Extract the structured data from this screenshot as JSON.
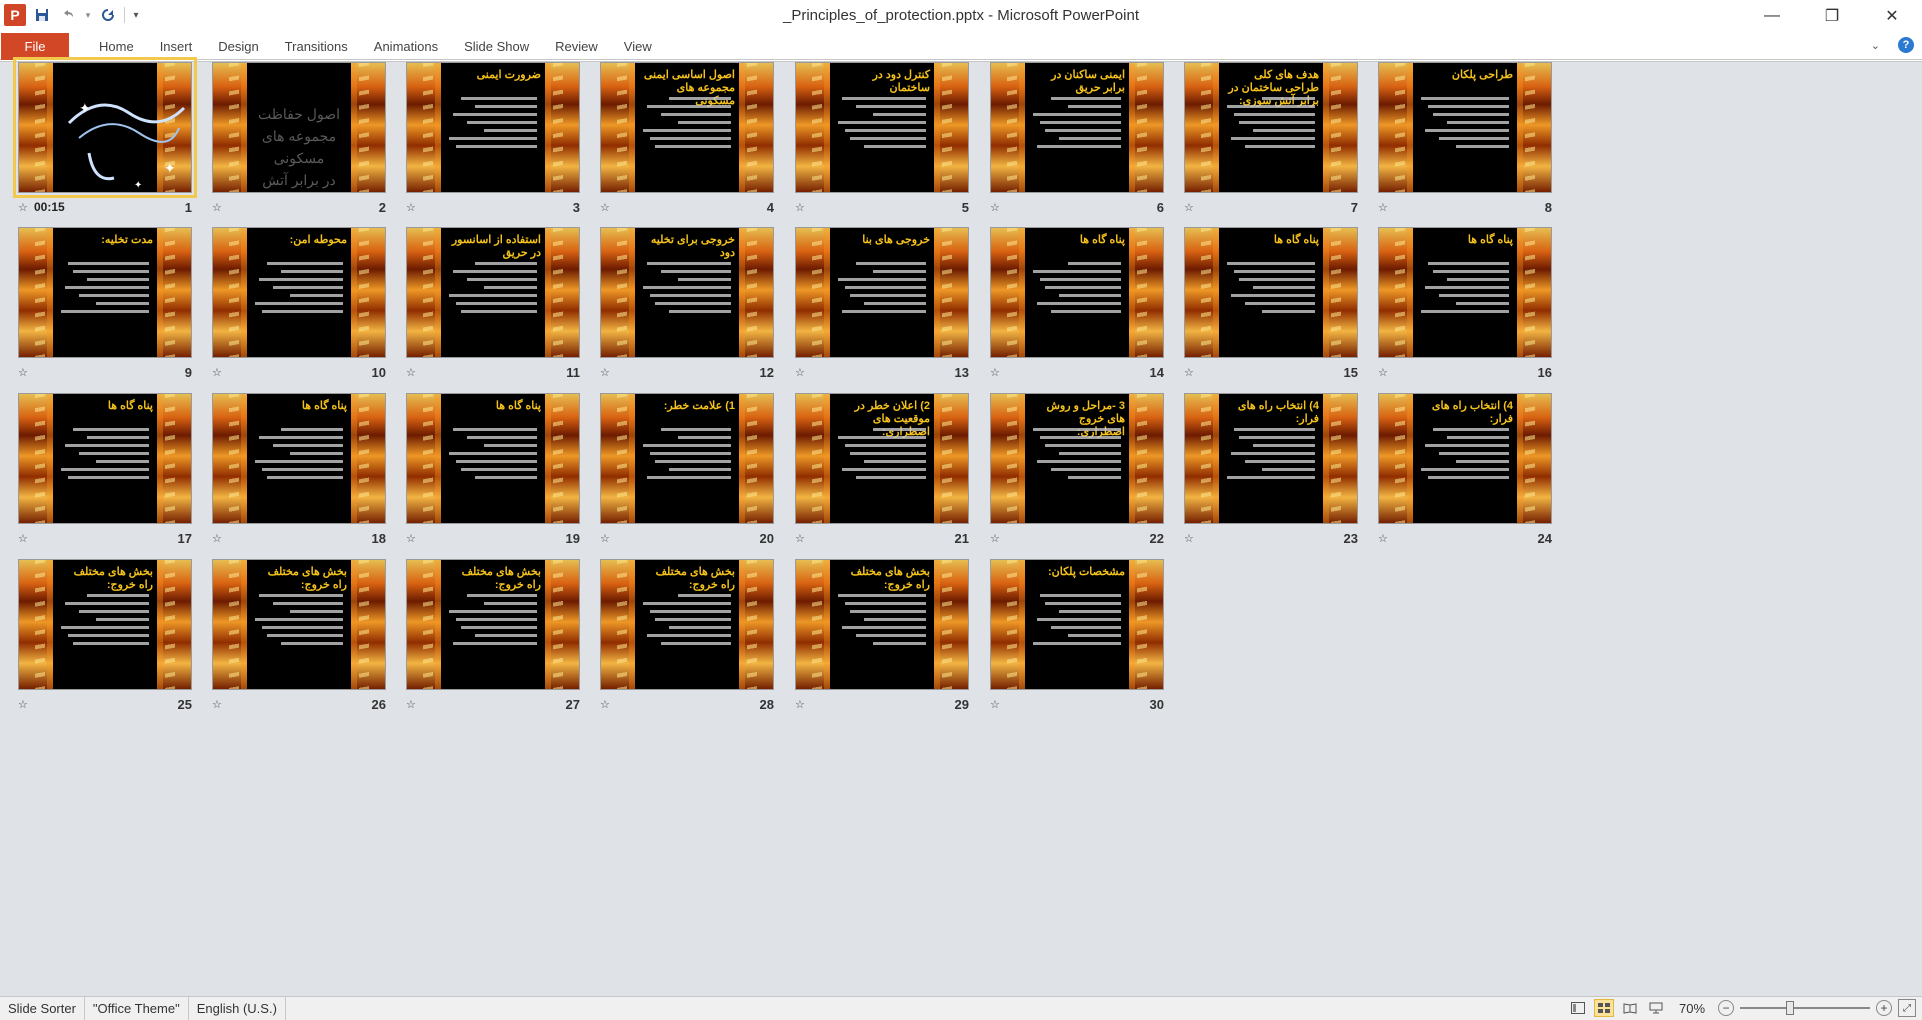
{
  "app": {
    "logo": "P",
    "window_title": "_Principles_of_protection.pptx - Microsoft PowerPoint"
  },
  "qat": {
    "save_icon": "save-icon",
    "undo_icon": "undo-icon",
    "redo_icon": "redo-icon",
    "customize_icon": "customize-icon"
  },
  "window_controls": {
    "minimize": "—",
    "restore": "❐",
    "close": "✕"
  },
  "ribbon": {
    "file_label": "File",
    "tabs": [
      "Home",
      "Insert",
      "Design",
      "Transitions",
      "Animations",
      "Slide Show",
      "Review",
      "View"
    ],
    "collapse_symbol": "⌄",
    "help_symbol": "?"
  },
  "slides": [
    {
      "number": "1",
      "title": "",
      "kind": "calligraphy",
      "timing": "00:15",
      "selected": true
    },
    {
      "number": "2",
      "title": "",
      "kind": "ghost",
      "ghost_lines": [
        "اصول حفاظت",
        "مجموعه های مسکونی",
        "در برابر آتش سوزی"
      ]
    },
    {
      "number": "3",
      "title": "ضرورت ایمنی"
    },
    {
      "number": "4",
      "title": "اصول اساسی ایمنی مجموعه های مسکونی"
    },
    {
      "number": "5",
      "title": "کنترل دود در ساختمان"
    },
    {
      "number": "6",
      "title": "ایمنی ساکنان در برابر حریق"
    },
    {
      "number": "7",
      "title": "هدف های کلی طراحی ساختمان در برابر آتش سوزی:"
    },
    {
      "number": "8",
      "title": "طراحی پلکان"
    },
    {
      "number": "9",
      "title": "مدت تخلیه:"
    },
    {
      "number": "10",
      "title": "محوطه امن:"
    },
    {
      "number": "11",
      "title": "استفاده از اسانسور در حریق"
    },
    {
      "number": "12",
      "title": "خروجی برای تخلیه دود"
    },
    {
      "number": "13",
      "title": "خروجی های بنا"
    },
    {
      "number": "14",
      "title": "پناه گاه ها"
    },
    {
      "number": "15",
      "title": "پناه گاه ها"
    },
    {
      "number": "16",
      "title": "پناه گاه ها"
    },
    {
      "number": "17",
      "title": "پناه گاه ها"
    },
    {
      "number": "18",
      "title": "پناه گاه ها"
    },
    {
      "number": "19",
      "title": "پناه گاه ها"
    },
    {
      "number": "20",
      "title": "1) علامت خطر:"
    },
    {
      "number": "21",
      "title": "2) اعلان خطر در موقعیت های اضطراری:"
    },
    {
      "number": "22",
      "title": "3 -مراحل و روش های خروج اضطراری:"
    },
    {
      "number": "23",
      "title": "4) انتخاب راه های فرار:"
    },
    {
      "number": "24",
      "title": "4) انتخاب راه های فرار:"
    },
    {
      "number": "25",
      "title": "بخش های مختلف راه خروج:"
    },
    {
      "number": "26",
      "title": "بخش های مختلف راه خروج:"
    },
    {
      "number": "27",
      "title": "بخش های مختلف راه خروج:"
    },
    {
      "number": "28",
      "title": "بخش های مختلف راه خروج:"
    },
    {
      "number": "29",
      "title": "بخش های مختلف راه خروج:"
    },
    {
      "number": "30",
      "title": "مشخصات پلکان:"
    }
  ],
  "status": {
    "view": "Slide Sorter",
    "theme": "\"Office Theme\"",
    "language": "English (U.S.)",
    "zoom": "70%",
    "zoom_fraction": 0.7
  }
}
